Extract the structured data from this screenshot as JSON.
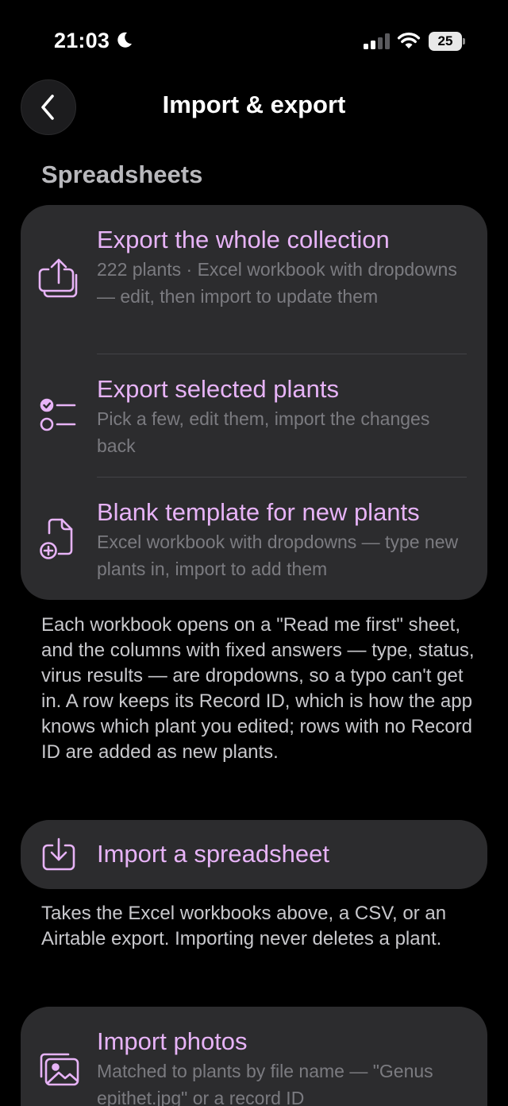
{
  "status_bar": {
    "time": "21:03",
    "battery": "25",
    "moon_icon": "moon-icon",
    "signal_icon": "cellular-signal-icon",
    "wifi_icon": "wifi-icon"
  },
  "nav": {
    "title": "Import & export",
    "back_icon": "chevron-left-icon"
  },
  "section": {
    "title": "Spreadsheets"
  },
  "export_card": {
    "items": [
      {
        "icon": "share-export-icon",
        "title": "Export the whole collection",
        "subtitle": "222 plants · Excel workbook with dropdowns — edit, then import to update them"
      },
      {
        "icon": "checklist-icon",
        "title": "Export selected plants",
        "subtitle": "Pick a few, edit them, import the changes back"
      },
      {
        "icon": "new-document-icon",
        "title": "Blank template for new plants",
        "subtitle": "Excel workbook with dropdowns — type new plants in, import to add them"
      }
    ]
  },
  "workbook_note": "Each workbook opens on a \"Read me first\" sheet, and the columns with fixed answers — type, status, virus results — are dropdowns, so a typo can't get in. A row keeps its Record ID, which is how the app knows which plant you edited; rows with no Record ID are added as new plants.",
  "import_card": {
    "icon": "import-tray-icon",
    "title": "Import a spreadsheet"
  },
  "import_note": "Takes the Excel workbooks above, a CSV, or an Airtable export. Importing never deletes a plant.",
  "photos_card": {
    "icon": "photos-icon",
    "title": "Import photos",
    "subtitle": "Matched to plants by file name — \"Genus epithet.jpg\" or a record ID"
  },
  "colors": {
    "accent": "#e7b3f7",
    "card": "#2c2c2e",
    "background": "#000000",
    "secondary_text": "#7b7b80"
  }
}
